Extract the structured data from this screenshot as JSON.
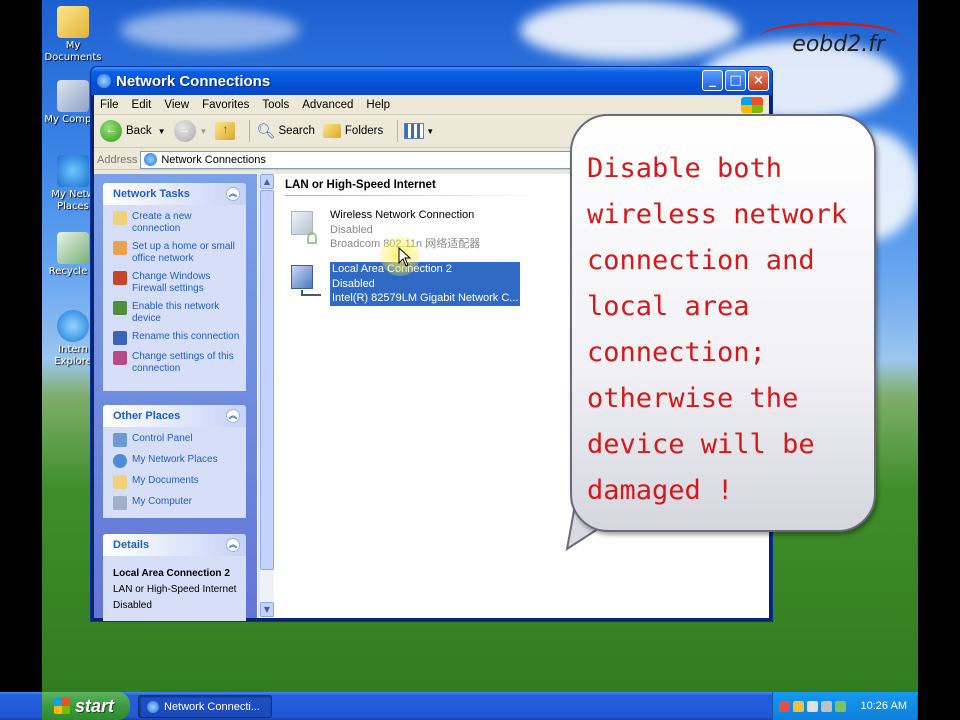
{
  "desktop": {
    "icons": [
      {
        "label": "My Documents",
        "icon": "my-documents-icon"
      },
      {
        "label": "My Comput",
        "icon": "my-computer-icon"
      },
      {
        "label": "My Netw Places",
        "icon": "network-places-icon"
      },
      {
        "label": "Recycle B",
        "icon": "recycle-bin-icon"
      },
      {
        "label": "Intern Explore",
        "icon": "internet-explorer-icon"
      }
    ],
    "logo": "eobd2.fr"
  },
  "window": {
    "title": "Network Connections",
    "menu": [
      "File",
      "Edit",
      "View",
      "Favorites",
      "Tools",
      "Advanced",
      "Help"
    ],
    "toolbar": {
      "back": "Back",
      "search": "Search",
      "folders": "Folders"
    },
    "address": {
      "label": "Address",
      "value": "Network Connections"
    },
    "network_tasks": {
      "title": "Network Tasks",
      "items": [
        "Create a new connection",
        "Set up a home or small office network",
        "Change Windows Firewall settings",
        "Enable this network device",
        "Rename this connection",
        "Change settings of this connection"
      ]
    },
    "other_places": {
      "title": "Other Places",
      "items": [
        "Control Panel",
        "My Network Places",
        "My Documents",
        "My Computer"
      ]
    },
    "details": {
      "title": "Details",
      "name": "Local Area Connection 2",
      "type": "LAN or High-Speed Internet",
      "status": "Disabled"
    },
    "group_header": "LAN or High-Speed Internet",
    "connections": [
      {
        "name": "Wireless Network Connection",
        "status": "Disabled",
        "device": "Broadcom 802.11n 网络适配器",
        "selected": false
      },
      {
        "name": "Local Area Connection 2",
        "status": "Disabled",
        "device": "Intel(R) 82579LM Gigabit Network C...",
        "selected": true
      }
    ]
  },
  "callout": {
    "text": "Disable both wireless network connection and local area connection; otherwise the device will be damaged !",
    "lines": [
      "Disable both",
      "wireless network",
      "connection and",
      "local area",
      "connection;",
      "otherwise the",
      "device will be",
      "damaged !"
    ],
    "color": "#d31919"
  },
  "taskbar": {
    "start": "start",
    "task": "Network Connecti...",
    "clock": "10:26 AM"
  }
}
